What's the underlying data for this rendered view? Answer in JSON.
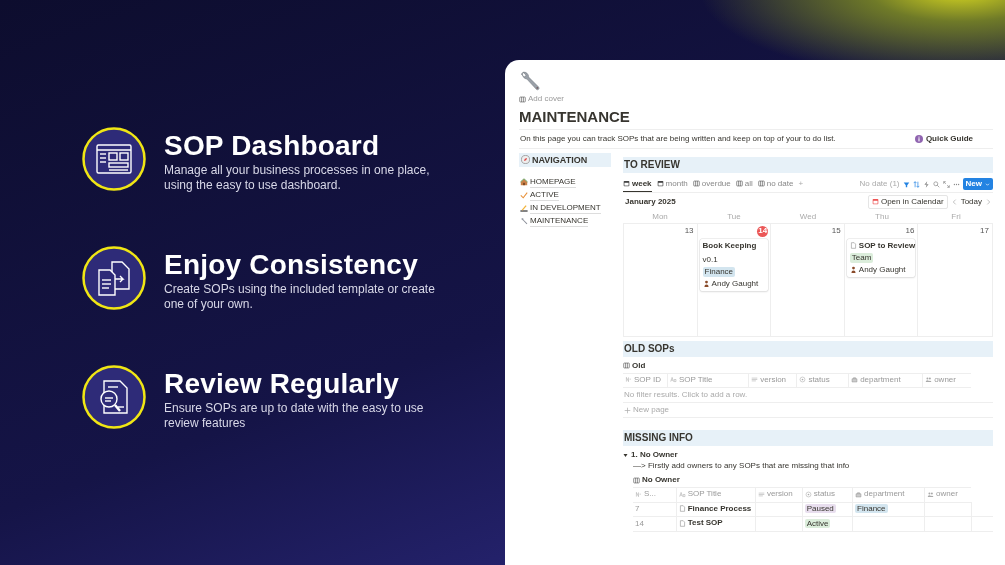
{
  "promo": {
    "features": [
      {
        "kind": "dashboard",
        "title": "SOP Dashboard",
        "description": "Manage all your business processes in one place, using the easy to use dashboard."
      },
      {
        "kind": "documents",
        "title": "Enjoy Consistency",
        "description": "Create SOPs using the included template or create one of your own."
      },
      {
        "kind": "review",
        "title": "Review Regularly",
        "description": "Ensure SOPs are up to date with the easy to use review features"
      }
    ]
  },
  "page": {
    "add_cover": "Add cover",
    "title": "MAINTENANCE",
    "description": "On this page you can track SOPs that are being written and keep on top of your to do list.",
    "quick_guide": "Quick Guide",
    "navigation": {
      "heading": "NAVIGATION",
      "items": [
        {
          "kind": "home",
          "label": "HOMEPAGE"
        },
        {
          "kind": "check",
          "label": "ACTIVE"
        },
        {
          "kind": "writing",
          "label": "IN DEVELOPMENT"
        },
        {
          "kind": "wrench",
          "label": "MAINTENANCE"
        }
      ]
    },
    "to_review": {
      "heading": "TO REVIEW",
      "views": [
        {
          "kind": "calendar",
          "label": "week",
          "selected": true
        },
        {
          "kind": "calendar",
          "label": "month",
          "selected": false
        },
        {
          "kind": "table",
          "label": "overdue",
          "selected": false
        },
        {
          "kind": "table",
          "label": "all",
          "selected": false
        },
        {
          "kind": "table",
          "label": "no date",
          "selected": false
        }
      ],
      "add_view": "+",
      "no_date": "No date (1)",
      "new_button": "New",
      "month": "January 2025",
      "open_in_calendar": "Open in Calendar",
      "today": "Today",
      "weekdays": [
        "Mon",
        "Tue",
        "Wed",
        "Thu",
        "Fri"
      ],
      "days": [
        {
          "number": "13",
          "today": false
        },
        {
          "number": "14",
          "today": true,
          "cards": [
            {
              "kind": "plain",
              "title": "Book Keeping",
              "version": "v0.1",
              "tag": {
                "label": "Finance",
                "color": "#d3e5ef"
              },
              "owner": "Andy Gaught"
            }
          ]
        },
        {
          "number": "15",
          "today": false
        },
        {
          "number": "16",
          "today": false,
          "cards": [
            {
              "kind": "document",
              "title": "SOP to Review",
              "tag": {
                "label": "Team",
                "color": "#dbeddb"
              },
              "owner": "Andy Gaught"
            }
          ]
        },
        {
          "number": "17",
          "today": false
        }
      ]
    },
    "old_sops": {
      "heading": "OLD SOPs",
      "view": "Old",
      "columns": [
        {
          "kind": "number",
          "label": "SOP ID"
        },
        {
          "kind": "title",
          "label": "SOP Title"
        },
        {
          "kind": "text",
          "label": "version"
        },
        {
          "kind": "status",
          "label": "status"
        },
        {
          "kind": "select",
          "label": "department"
        },
        {
          "kind": "person",
          "label": "owner"
        }
      ],
      "empty": "No filter results. Click to add a row.",
      "new_page": "New page"
    },
    "missing_info": {
      "heading": "MISSING INFO",
      "groups": [
        {
          "title": "1. No Owner",
          "expanded": true,
          "note": "—> Firstly add owners to any SOPs that are missing that info",
          "view": "No Owner",
          "columns": [
            {
              "kind": "number",
              "label": "S..."
            },
            {
              "kind": "title",
              "label": "SOP Title"
            },
            {
              "kind": "text",
              "label": "version"
            },
            {
              "kind": "status",
              "label": "status"
            },
            {
              "kind": "select",
              "label": "department"
            },
            {
              "kind": "person",
              "label": "owner"
            }
          ],
          "rows": [
            {
              "id": "7",
              "title": "Finance Process",
              "status": {
                "label": "Paused",
                "color": "#e8deee"
              },
              "department": {
                "label": "Finance",
                "color": "#d3e5ef"
              }
            },
            {
              "id": "14",
              "title": "Test SOP",
              "status": {
                "label": "Active",
                "color": "#dbeddb"
              }
            }
          ]
        }
      ]
    }
  }
}
